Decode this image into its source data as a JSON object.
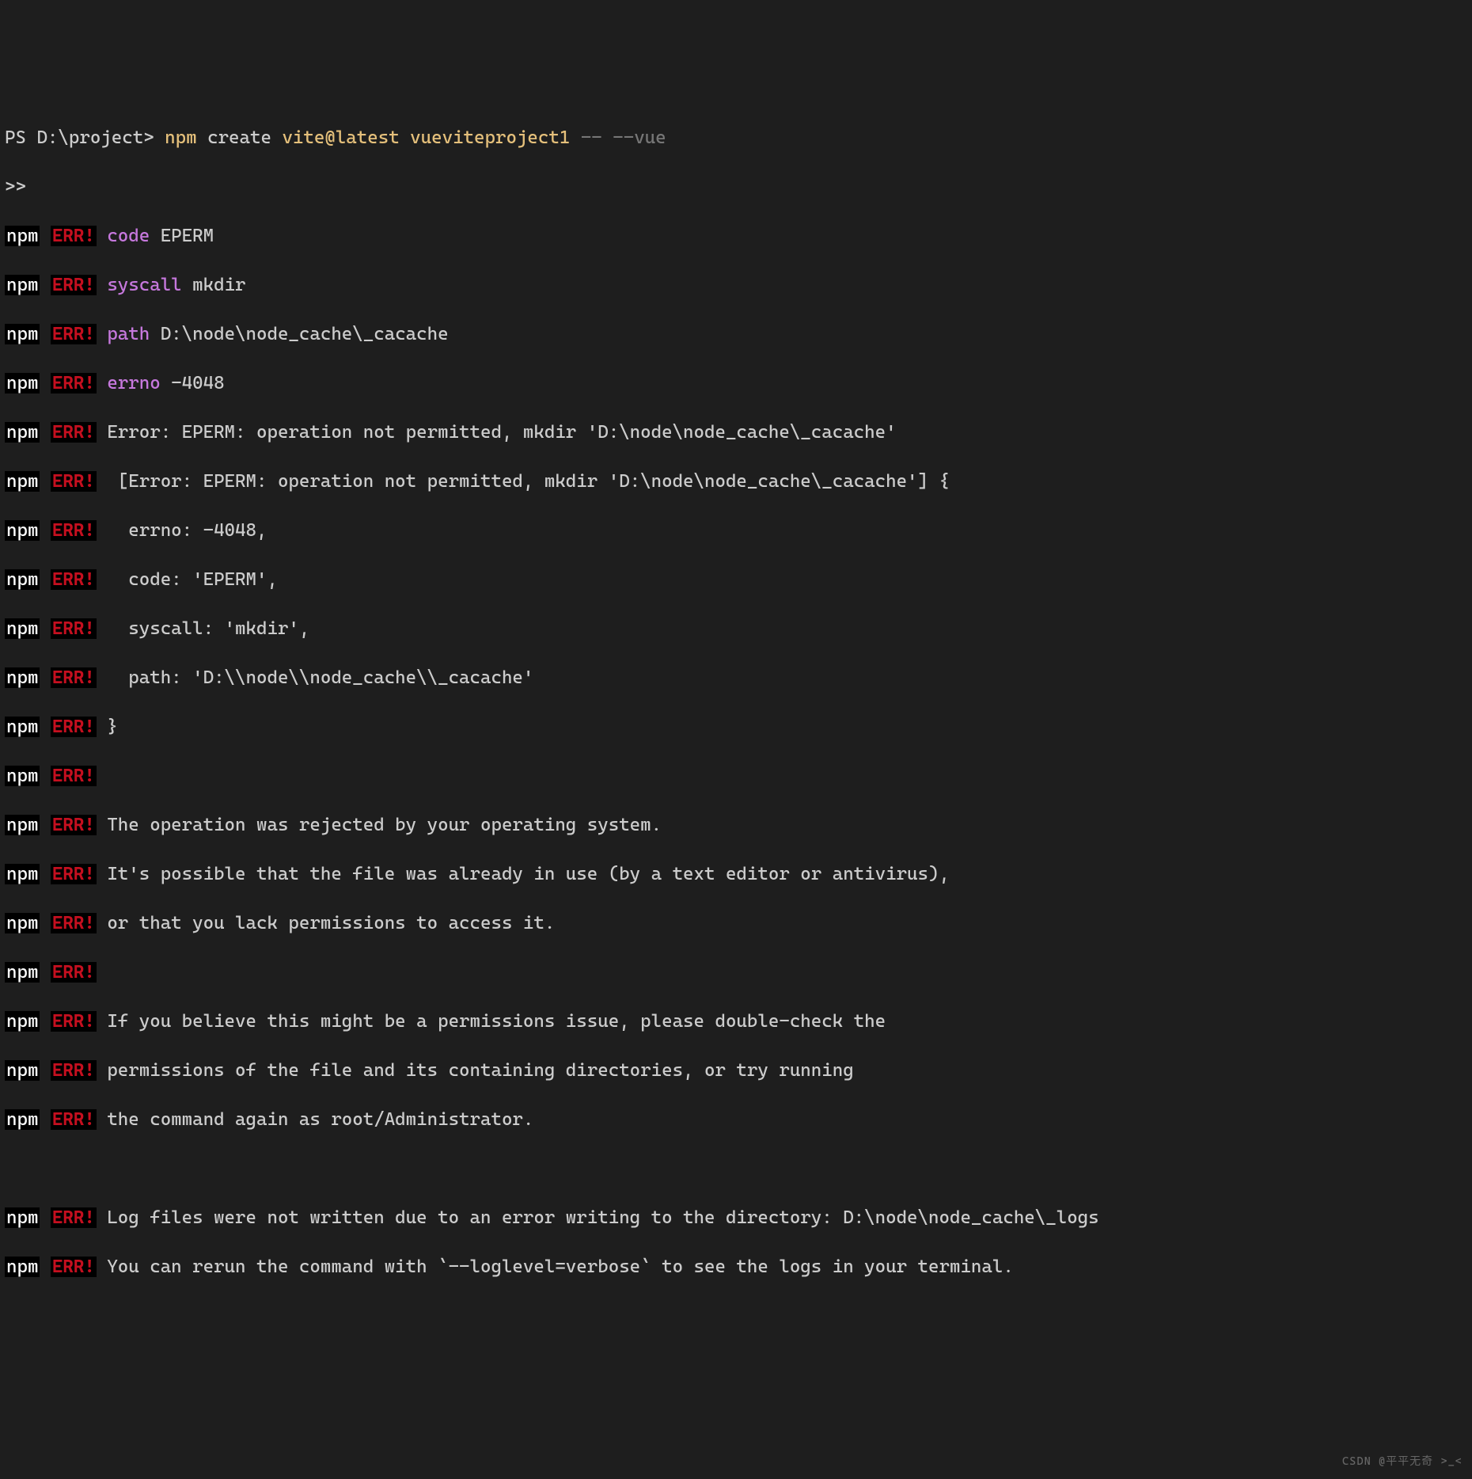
{
  "prompt": {
    "ps": "PS",
    "cwd": "D:\\project>",
    "cmd_bin": "npm",
    "cmd_part1": "create",
    "cmd_args_y1": "vite@latest",
    "cmd_args_y2": "vueviteproject1",
    "cmd_tail": "-- --vue"
  },
  "continuation": ">>",
  "labels": {
    "npm": "npm",
    "err": "ERR!"
  },
  "fields": {
    "code_k": "code",
    "code_v": "EPERM",
    "syscall_k": "syscall",
    "syscall_v": "mkdir",
    "path_k": "path",
    "path_v": "D:\\node\\node_cache\\_cacache",
    "errno_k": "errno",
    "errno_v": "-4048"
  },
  "msg1": "Error: EPERM: operation not permitted, mkdir 'D:\\node\\node_cache\\_cacache'",
  "msg2": " [Error: EPERM: operation not permitted, mkdir 'D:\\node\\node_cache\\_cacache'] {",
  "obj": {
    "l1": "  errno: -4048,",
    "l2": "  code: 'EPERM',",
    "l3": "  syscall: 'mkdir',",
    "l4": "  path: 'D:\\\\node\\\\node_cache\\\\_cacache'",
    "l5": "}"
  },
  "para1": {
    "l1": "The operation was rejected by your operating system.",
    "l2": "It's possible that the file was already in use (by a text editor or antivirus),",
    "l3": "or that you lack permissions to access it."
  },
  "para2": {
    "l1": "If you believe this might be a permissions issue, please double-check the",
    "l2": "permissions of the file and its containing directories, or try running",
    "l3": "the command again as root/Administrator."
  },
  "para3": {
    "l1": "Log files were not written due to an error writing to the directory: D:\\node\\node_cache\\_logs",
    "l2": "You can rerun the command with `--loglevel=verbose` to see the logs in your terminal."
  },
  "watermark": "CSDN @平平无奇 >_<"
}
